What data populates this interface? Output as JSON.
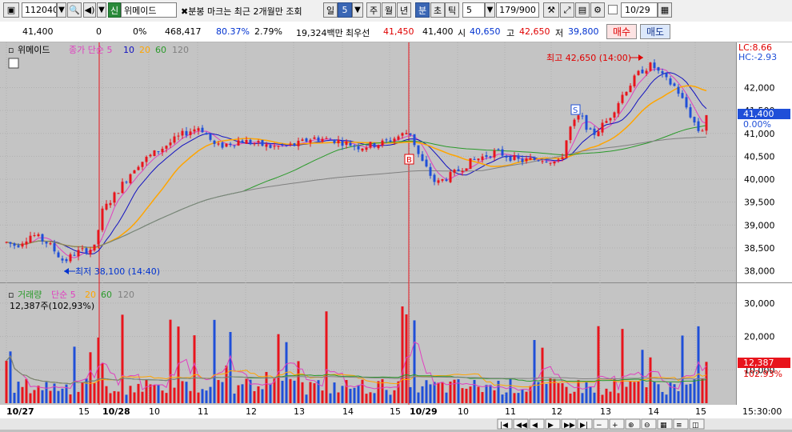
{
  "toolbar": {
    "code": "112040",
    "search_icon": "search-icon",
    "speaker_icon": "speaker-icon",
    "badge": "신",
    "stock_name": "위메이드",
    "notice": "분봉 마크는 최근 2개월만 조회",
    "periods": [
      "일",
      "5",
      "주",
      "월",
      "년",
      "분",
      "초",
      "틱"
    ],
    "active_period_index": 5,
    "minute_value": "5",
    "count": "179/900",
    "date": "10/29"
  },
  "quote": {
    "price": "41,400",
    "change": "0",
    "change_pct": "0%",
    "volume": "468,417",
    "vol_ratio": "80.37%",
    "turnover_ratio": "2.79%",
    "amount": "19,324백만",
    "best_ask_label": "최우선",
    "best_ask": "41,450",
    "best_bid": "41,400",
    "open_label": "시",
    "open": "40,650",
    "high_label": "고",
    "high": "42,650",
    "low_label": "저",
    "low": "39,800",
    "buy_button": "매수",
    "sell_button": "매도"
  },
  "chart": {
    "price_legend": {
      "name": "위메이드",
      "ma_label": "종가 단순 5",
      "ma10": "10",
      "ma20": "20",
      "ma60": "60",
      "ma120": "120"
    },
    "volume_legend": {
      "name": "거래량",
      "ma_label": "단순 5",
      "ma20": "20",
      "ma60": "60",
      "ma120": "120",
      "value": "12,387주(102,93%)"
    },
    "lc_label": "LC:8.66",
    "hc_label": "HC:-2.93",
    "high_annotation": "최고 42,650 (14:00)",
    "low_annotation": "최저 38,100 (14:40)",
    "current_price_tag": "41,400",
    "current_pct_tag": "0.00%",
    "current_vol_tag": "12,387",
    "current_vol_pct": "102.93%",
    "marker_b": "B",
    "marker_s": "S",
    "time_label": "15:30:00",
    "colors": {
      "up": "#e8141c",
      "down": "#1f4fd8",
      "ma5": "#e040c0",
      "ma10": "#1010c0",
      "ma20": "#ffa500",
      "ma60": "#2a9a2a",
      "ma120": "#808080"
    }
  },
  "chart_data": {
    "type": "candlestick",
    "price_axis": [
      "42,000",
      "41,500",
      "41,000",
      "40,500",
      "40,000",
      "39,500",
      "39,000",
      "38,500",
      "38,000"
    ],
    "price_range": [
      37800,
      42900
    ],
    "volume_axis": [
      "30,000",
      "20,000",
      "10,000"
    ],
    "volume_range": [
      0,
      35000
    ],
    "x_labels": [
      "10/27",
      "15",
      "10/28",
      "10",
      "11",
      "12",
      "13",
      "14",
      "15",
      "10/29",
      "10",
      "11",
      "12",
      "13",
      "14",
      "15"
    ],
    "ma_series": [
      "5",
      "10",
      "20",
      "60",
      "120"
    ],
    "high": {
      "value": 42650,
      "time": "14:00"
    },
    "low": {
      "value": 38100,
      "time": "14:40"
    }
  },
  "scroll": {
    "buttons": [
      "|◀",
      "◀◀",
      "◀",
      "▶",
      "▶▶",
      "▶|",
      "−",
      "+",
      "⊕",
      "⊖",
      "▦",
      "≡",
      "◫"
    ]
  }
}
